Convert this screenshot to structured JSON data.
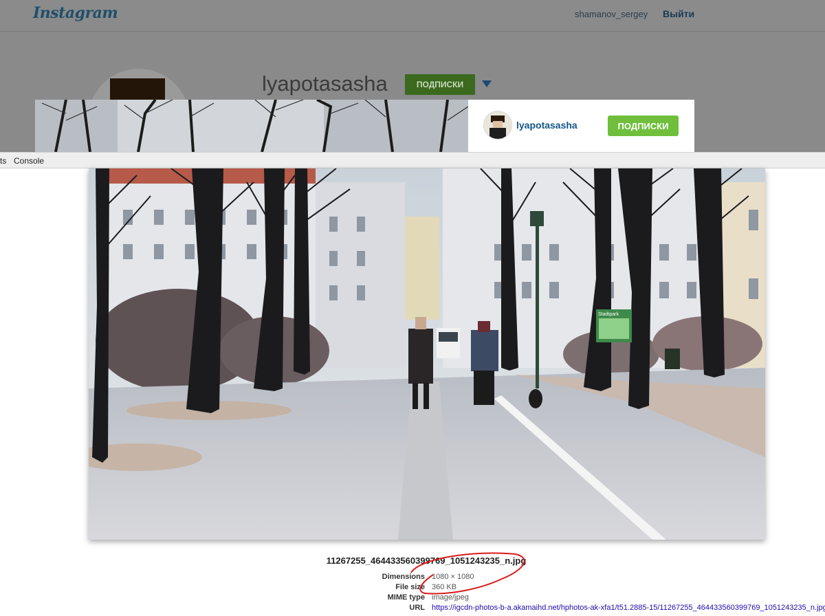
{
  "instagram": {
    "logo": "Instagram",
    "current_user": "shamanov_sergey",
    "logout_label": "Выйти",
    "profile": {
      "username": "lyapotasasha",
      "follow_label": "ПОДПИСКИ"
    }
  },
  "lightbox": {
    "username": "lyapotasasha",
    "follow_label": "ПОДПИСКИ"
  },
  "devtools": {
    "tab_cut": "ts",
    "tab_console": "Console"
  },
  "image_info": {
    "filename": "11267255_464433560399769_1051243235_n.jpg",
    "dimensions_label": "Dimensions",
    "dimensions_value": "1080 × 1080",
    "file_size_label": "File size",
    "file_size_value": "360 KB",
    "mime_label": "MIME type",
    "mime_value": "image/jpeg",
    "url_label": "URL",
    "url_value": "https://igcdn-photos-b-a.akamaihd.net/hphotos-ak-xfa1/t51.2885-15/11267255_464433560399769_1051243235_n.jpg"
  },
  "photo": {
    "sign_text": "Stadtpark"
  },
  "colors": {
    "follow_green": "#6fbf3c",
    "link_blue": "#125688",
    "annotation_red": "#d81a1a"
  }
}
